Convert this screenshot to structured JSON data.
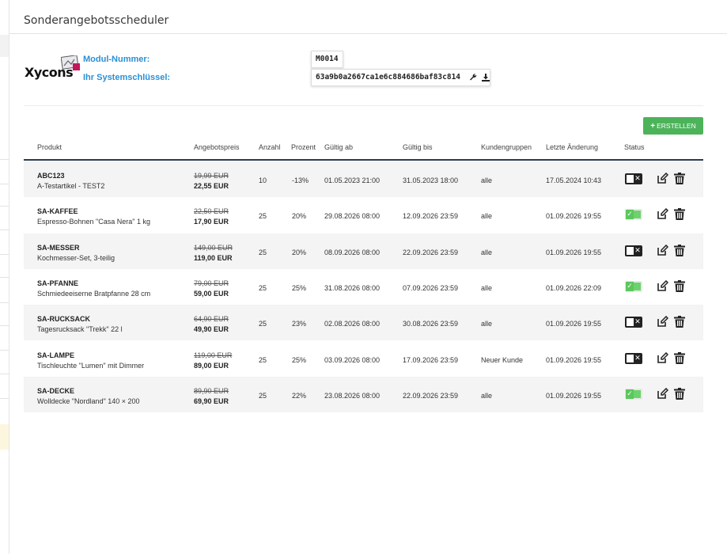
{
  "page": {
    "title": "Sonderangebotsscheduler"
  },
  "logo": {
    "text": "Xycons"
  },
  "module": {
    "number_label": "Modul-Nummer:",
    "number_value": "M0014",
    "key_label": "Ihr Systemschlüssel:",
    "key_value": "63a9b0a2667ca1e6c884686baf83c814"
  },
  "toolbar": {
    "create_label": "ERSTELLEN",
    "create_icon": "plus-icon"
  },
  "table": {
    "columns": [
      "Produkt",
      "Angebotspreis",
      "Anzahl",
      "Prozent",
      "Gültig ab",
      "Gültig bis",
      "Kundengruppen",
      "Letzte Änderung",
      "Status"
    ],
    "rows": [
      {
        "sku": "ABC123",
        "name": "A-Testartikel - TEST2",
        "old_price": "19,99 EUR",
        "new_price": "22,55 EUR",
        "anzahl": "10",
        "prozent": "-13%",
        "ab": "01.05.2023 21:00",
        "bis": "31.05.2023 18:00",
        "gruppen": "alle",
        "geaendert": "17.05.2024 10:43",
        "active": false
      },
      {
        "sku": "SA-KAFFEE",
        "name": "Espresso-Bohnen \"Casa Nera\" 1 kg",
        "old_price": "22,50 EUR",
        "new_price": "17,90 EUR",
        "anzahl": "25",
        "prozent": "20%",
        "ab": "29.08.2026 08:00",
        "bis": "12.09.2026 23:59",
        "gruppen": "alle",
        "geaendert": "01.09.2026 19:55",
        "active": true
      },
      {
        "sku": "SA-MESSER",
        "name": "Kochmesser-Set, 3-teilig",
        "old_price": "149,00 EUR",
        "new_price": "119,00 EUR",
        "anzahl": "25",
        "prozent": "20%",
        "ab": "08.09.2026 08:00",
        "bis": "22.09.2026 23:59",
        "gruppen": "alle",
        "geaendert": "01.09.2026 19:55",
        "active": false
      },
      {
        "sku": "SA-PFANNE",
        "name": "Schmiedeeiserne Bratpfanne 28 cm",
        "old_price": "79,00 EUR",
        "new_price": "59,00 EUR",
        "anzahl": "25",
        "prozent": "25%",
        "ab": "31.08.2026 08:00",
        "bis": "07.09.2026 23:59",
        "gruppen": "alle",
        "geaendert": "01.09.2026 22:09",
        "active": true
      },
      {
        "sku": "SA-RUCKSACK",
        "name": "Tagesrucksack \"Trekk\" 22 l",
        "old_price": "64,90 EUR",
        "new_price": "49,90 EUR",
        "anzahl": "25",
        "prozent": "23%",
        "ab": "02.08.2026 08:00",
        "bis": "30.08.2026 23:59",
        "gruppen": "alle",
        "geaendert": "01.09.2026 19:55",
        "active": false
      },
      {
        "sku": "SA-LAMPE",
        "name": "Tischleuchte \"Lumen\" mit Dimmer",
        "old_price": "119,00 EUR",
        "new_price": "89,00 EUR",
        "anzahl": "25",
        "prozent": "25%",
        "ab": "03.09.2026 08:00",
        "bis": "17.09.2026 23:59",
        "gruppen": "Neuer Kunde",
        "geaendert": "01.09.2026 19:55",
        "active": false
      },
      {
        "sku": "SA-DECKE",
        "name": "Wolldecke \"Nordland\" 140 × 200",
        "old_price": "89,90 EUR",
        "new_price": "69,90 EUR",
        "anzahl": "25",
        "prozent": "22%",
        "ab": "23.08.2026 08:00",
        "bis": "22.09.2026 23:59",
        "gruppen": "alle",
        "geaendert": "01.09.2026 19:55",
        "active": true
      }
    ]
  },
  "icons": {
    "edit": "edit-icon",
    "delete": "trash-icon",
    "wrench": "wrench-icon",
    "download": "download-icon"
  },
  "colors": {
    "accent_blue": "#2b8fd6",
    "create_green": "#4cb35a",
    "toggle_on": "#6bd36b",
    "header_rule": "#2b3a4a"
  }
}
